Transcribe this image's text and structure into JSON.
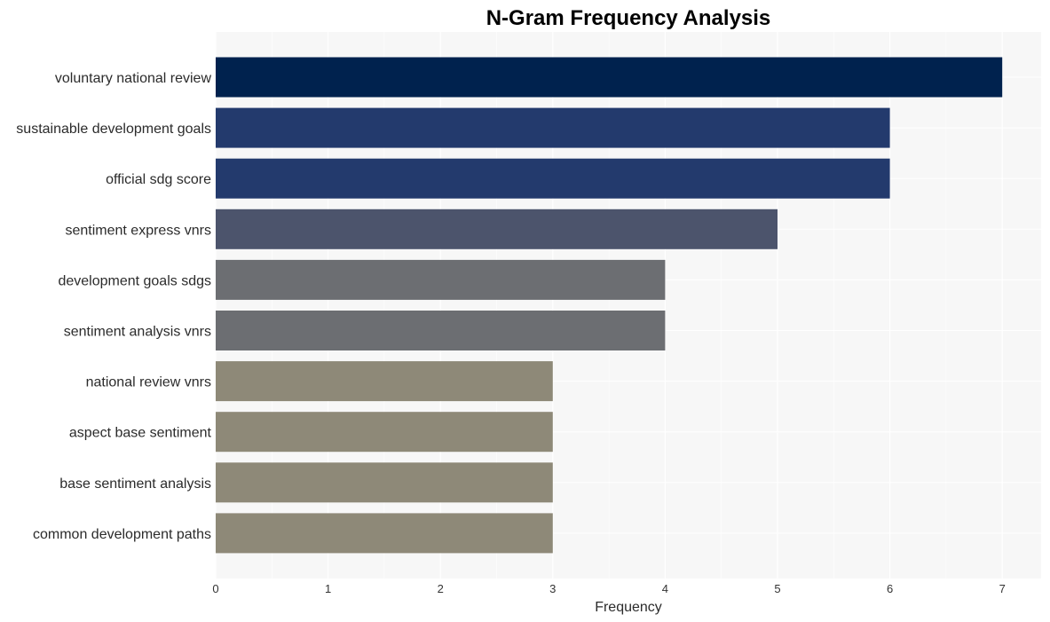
{
  "chart_data": {
    "type": "bar",
    "orientation": "horizontal",
    "title": "N-Gram Frequency Analysis",
    "xlabel": "Frequency",
    "ylabel": "",
    "xlim": [
      0,
      7.35
    ],
    "xticks": [
      0,
      1,
      2,
      3,
      4,
      5,
      6,
      7
    ],
    "grid": true,
    "legend": "none",
    "categories": [
      "voluntary national review",
      "sustainable development goals",
      "official sdg score",
      "sentiment express vnrs",
      "development goals sdgs",
      "sentiment analysis vnrs",
      "national review vnrs",
      "aspect base sentiment",
      "base sentiment analysis",
      "common development paths"
    ],
    "values": [
      7,
      6,
      6,
      5,
      4,
      4,
      3,
      3,
      3,
      3
    ],
    "colors": [
      "#00224e",
      "#233a6d",
      "#233a6d",
      "#4c546c",
      "#6c6e72",
      "#6c6e72",
      "#8e8978",
      "#8e8978",
      "#8e8978",
      "#8e8978"
    ],
    "plot_background": "#f7f7f7",
    "grid_color": "#ffffff"
  }
}
